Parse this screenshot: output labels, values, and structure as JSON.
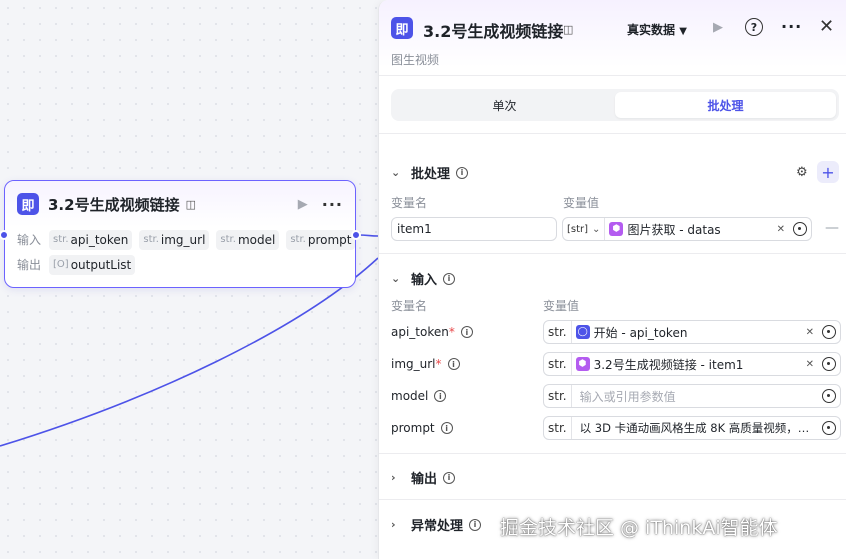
{
  "node": {
    "icon": "即",
    "title": "3.2号生成视频链接",
    "input_label": "输入",
    "output_label": "输出",
    "inputs": [
      {
        "type": "str.",
        "name": "api_token"
      },
      {
        "type": "str.",
        "name": "img_url"
      },
      {
        "type": "str.",
        "name": "model"
      },
      {
        "type": "str.",
        "name": "prompt"
      }
    ],
    "output": {
      "type": "[O]",
      "name": "outputList"
    }
  },
  "panel": {
    "icon": "即",
    "title": "3.2号生成视频链接",
    "mode": "真实数据",
    "subtitle": "图生视频",
    "tabs": [
      "单次",
      "批处理"
    ],
    "active_tab": 1,
    "batch": {
      "title": "批处理",
      "col_name": "变量名",
      "col_value": "变量值",
      "item_name": "item1",
      "item_type": "[str]",
      "item_ref": "图片获取 - datas"
    },
    "inputs": {
      "title": "输入",
      "col_name": "变量名",
      "col_value": "变量值",
      "params": [
        {
          "name": "api_token",
          "required": "*",
          "type": "str.",
          "ref": "开始 - api_token",
          "ref_icon": "blue"
        },
        {
          "name": "img_url",
          "required": "*",
          "type": "str.",
          "ref": "3.2号生成视频链接 - item1",
          "ref_icon": "purple"
        },
        {
          "name": "model",
          "required": "",
          "type": "str.",
          "placeholder": "输入或引用参数值"
        },
        {
          "name": "prompt",
          "required": "",
          "type": "str.",
          "value": "以 3D 卡通动画风格生成 8K 高质量视频，…"
        }
      ]
    },
    "output_title": "输出",
    "exception_title": "异常处理"
  },
  "watermark": "掘金技术社区 @ iThinkAi智能体",
  "colors": {
    "accent": "#4d53e8",
    "edge": "#4d53e8",
    "required": "#e8484a"
  }
}
